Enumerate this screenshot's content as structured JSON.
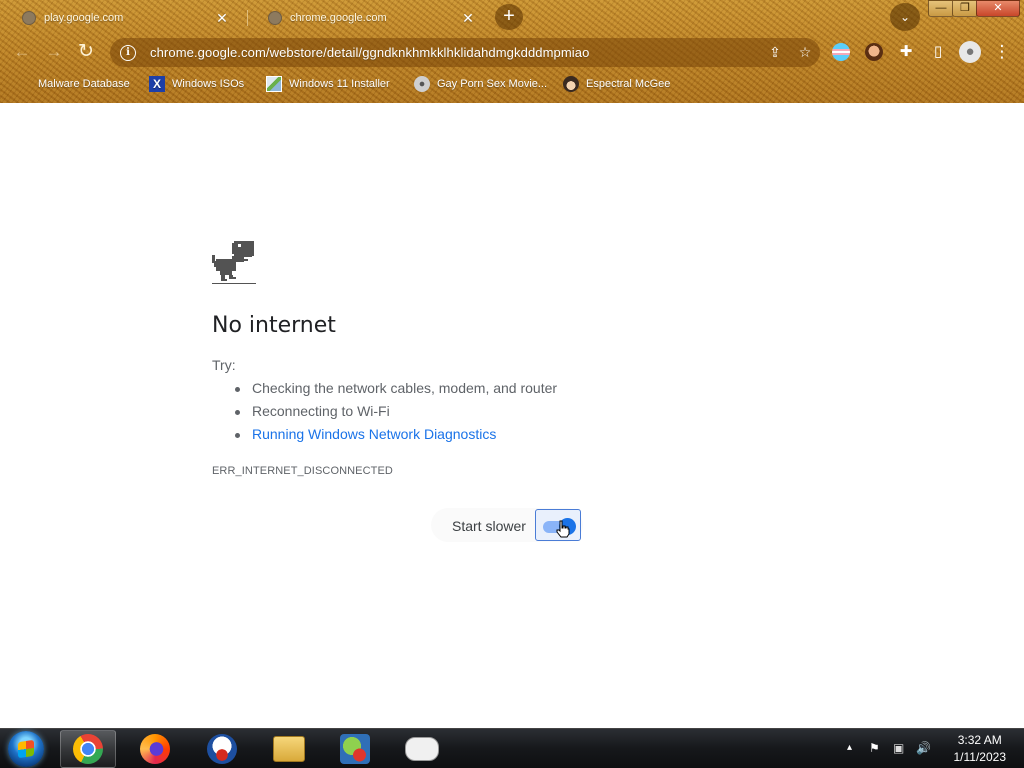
{
  "browser": {
    "tabs": [
      {
        "title": "play.google.com",
        "close": "✕"
      },
      {
        "title": "chrome.google.com",
        "close": "✕"
      }
    ],
    "new_tab": "+",
    "tab_search": "⌄",
    "window_controls": {
      "minimize": "—",
      "maximize": "❐",
      "close": "✕"
    },
    "toolbar": {
      "back": "←",
      "forward": "→",
      "reload": "↻",
      "url": "chrome.google.com/webstore/detail/ggndknkhmkklhklidahdmgkdddmpmiao",
      "share": "⇪",
      "star": "☆",
      "extensions": "✚",
      "side_panel": "▯",
      "menu": "⋮"
    },
    "bookmarks": [
      {
        "label": "Malware Database",
        "icon": "none"
      },
      {
        "label": "Windows ISOs",
        "icon": "x-logo-icon"
      },
      {
        "label": "Windows 11 Installer",
        "icon": "image-icon"
      },
      {
        "label": "Gay Porn Sex Movie...",
        "icon": "disc-icon"
      },
      {
        "label": "Espectral McGee",
        "icon": "avatar-icon"
      }
    ]
  },
  "error_page": {
    "title": "No internet",
    "try_label": "Try:",
    "suggestions": [
      "Checking the network cables, modem, and router",
      "Reconnecting to Wi-Fi"
    ],
    "diagnostics_link": "Running Windows Network Diagnostics",
    "error_code": "ERR_INTERNET_DISCONNECTED",
    "toggle_label": "Start slower",
    "toggle_on": true
  },
  "taskbar": {
    "apps": [
      "chrome",
      "firefox",
      "obama",
      "file-explorer",
      "network-tool",
      "gamepad"
    ],
    "clock": {
      "time": "3:32 AM",
      "date": "1/11/2023"
    },
    "tray": {
      "show_hidden": "▴",
      "flag": "⚑",
      "network": "▣",
      "volume": "🔊"
    }
  },
  "colors": {
    "link": "#1a73e8",
    "toggle_thumb": "#1a73e8",
    "theme": "#b97e22"
  }
}
